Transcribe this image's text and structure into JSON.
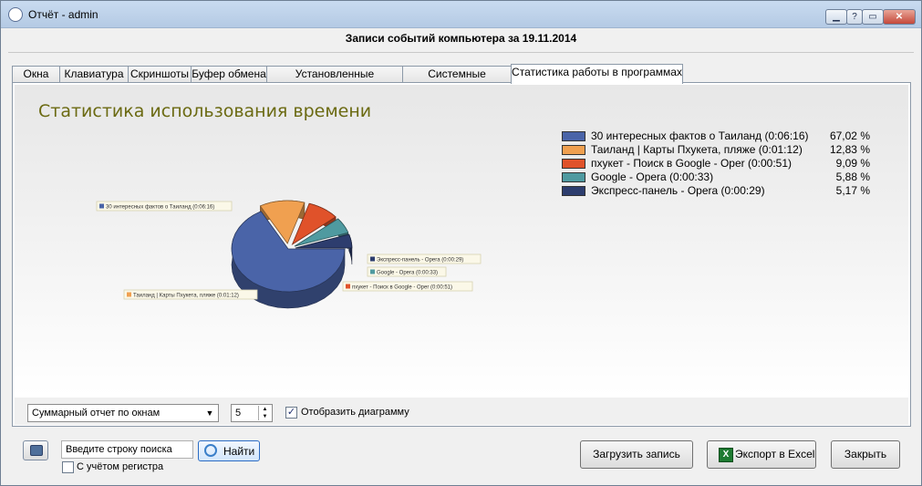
{
  "window": {
    "title": "Отчёт - admin",
    "controls": {
      "help": "?",
      "close": "✕"
    }
  },
  "header": {
    "title": "Записи событий компьютера за 19.11.2014"
  },
  "tabs": [
    {
      "label": "Окна"
    },
    {
      "label": "Клавиатура"
    },
    {
      "label": "Скриншоты"
    },
    {
      "label": "Буфер обмена"
    },
    {
      "label": "Установленные программы"
    },
    {
      "label": "Системные сведения"
    },
    {
      "label": "Статистика работы в программах",
      "active": true
    }
  ],
  "chart_data": {
    "type": "pie",
    "title": "Статистика использования времени",
    "legend_position": "top-right",
    "slices": [
      {
        "label": "30 интересных фактов о Таиланд (0:06:16)",
        "value": 67.02,
        "pct_text": "67,02 %",
        "color": "#4a64a8"
      },
      {
        "label": "Таиланд | Карты Пхукета, пляже (0:01:12)",
        "value": 12.83,
        "pct_text": "12,83 %",
        "color": "#f0a050"
      },
      {
        "label": "пхукет - Поиск в Google - Oper (0:00:51)",
        "value": 9.09,
        "pct_text": "9,09 %",
        "color": "#e0522a"
      },
      {
        "label": "Google - Opera (0:00:33)",
        "value": 5.88,
        "pct_text": "5,88 %",
        "color": "#4f9aa0"
      },
      {
        "label": "Экспресс-панель - Opera (0:00:29)",
        "value": 5.17,
        "pct_text": "5,17 %",
        "color": "#2d3d6e"
      }
    ],
    "callouts": [
      "30 интересных фактов о Таиланд (0:06:16)",
      "Таиланд | Карты Пхукета, пляже (0:01:12)",
      "пхукет - Поиск в Google - Oper (0:00:51)",
      "Google - Opera (0:00:33)",
      "Экспресс-панель - Opera (0:00:29)"
    ]
  },
  "controls": {
    "report_type": "Суммарный отчет по окнам",
    "top_count": "5",
    "show_chart_label": "Отобразить диаграмму",
    "show_chart_checked": "✓"
  },
  "footer": {
    "search_placeholder": "Введите строку поиска",
    "find_label": "Найти",
    "case_sensitive_label": "С учётом регистра",
    "load_label": "Загрузить запись",
    "excel_label": "Экспорт в Excel",
    "excel_icon_text": "X",
    "close_label": "Закрыть"
  }
}
